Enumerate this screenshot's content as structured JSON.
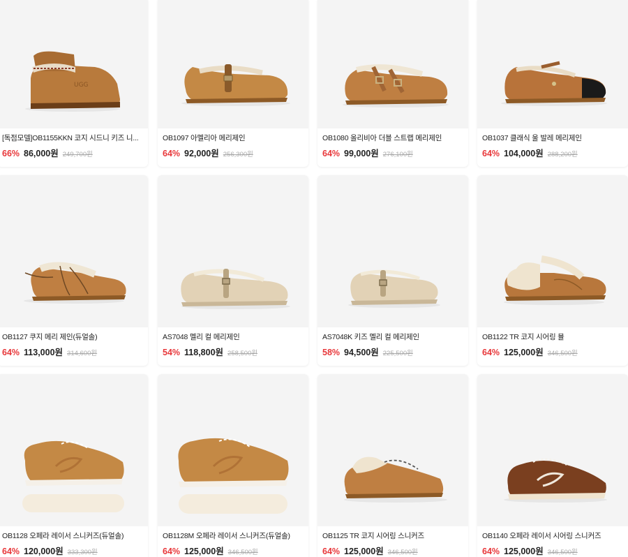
{
  "colors": {
    "discount": "#e8373a",
    "card_bg": "#f4f4f4",
    "orig_price": "#aaaaaa"
  },
  "products": [
    {
      "title": "[독점모델]OB1155KKN 코지 시드니 키즈 니...",
      "discount": "66%",
      "price": "86,000원",
      "orig_price": "249,700원",
      "icon": "tasman-slipper-icon"
    },
    {
      "title": "OB1097 아멜리아 메리제인",
      "discount": "64%",
      "price": "92,000원",
      "orig_price": "256,300원",
      "icon": "mary-jane-shoe-icon"
    },
    {
      "title": "OB1080 올리비아 더블 스트랩 메리제인",
      "discount": "64%",
      "price": "99,000원",
      "orig_price": "276,100원",
      "icon": "double-strap-mary-jane-icon"
    },
    {
      "title": "OB1037 클래식 울 발레 메리제인",
      "discount": "64%",
      "price": "104,000원",
      "orig_price": "288,200원",
      "icon": "ballet-flat-cap-toe-icon"
    },
    {
      "title": "OB1127 쿠지 메리 제인(듀얼솔)",
      "discount": "64%",
      "price": "113,000원",
      "orig_price": "314,600원",
      "icon": "lace-up-mary-jane-icon"
    },
    {
      "title": "AS7048 멜리 컬 메리제인",
      "discount": "54%",
      "price": "118,800원",
      "orig_price": "258,500원",
      "icon": "curly-wool-mary-jane-icon"
    },
    {
      "title": "AS7048K 키즈 멜리 컬 메리제인",
      "discount": "58%",
      "price": "94,500원",
      "orig_price": "225,500원",
      "icon": "kids-curly-mary-jane-icon"
    },
    {
      "title": "OB1122 TR 코지 시어링 뮬",
      "discount": "64%",
      "price": "125,000원",
      "orig_price": "346,500원",
      "icon": "shearling-mule-icon"
    },
    {
      "title": "OB1128 오페라 레이서 스니커즈(듀얼솔)",
      "discount": "64%",
      "price": "120,000원",
      "orig_price": "333,300원",
      "icon": "racer-sneaker-icon"
    },
    {
      "title": "OB1128M 오페라 레이서 스니커즈(듀얼솔)",
      "discount": "64%",
      "price": "125,000원",
      "orig_price": "346,500원",
      "icon": "racer-sneaker-icon"
    },
    {
      "title": "OB1125 TR 코지 시어링 스니커즈",
      "discount": "64%",
      "price": "125,000원",
      "orig_price": "346,500원",
      "icon": "shearling-sneaker-icon"
    },
    {
      "title": "OB1140 오페라 레이서 시어링 스니커즈",
      "discount": "64%",
      "price": "125,000원",
      "orig_price": "346,500원",
      "icon": "dark-racer-sneaker-icon"
    }
  ]
}
